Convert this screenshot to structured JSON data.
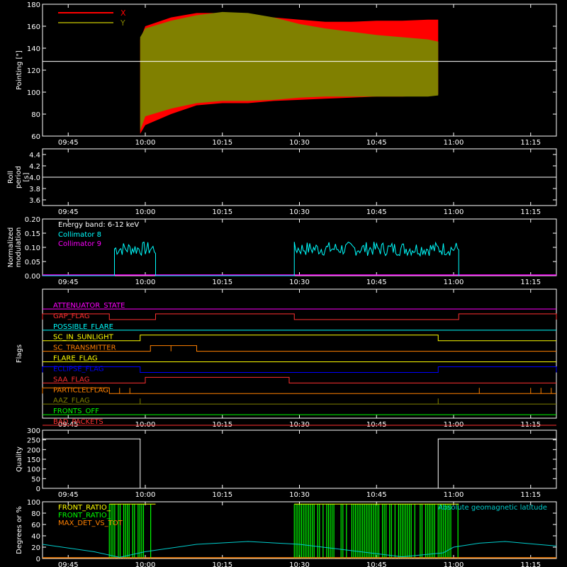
{
  "colors": {
    "background": "#000000",
    "axis": "#ffffff",
    "x_series": "#ff0000",
    "y_series": "#808000",
    "collimator8": "#00ffff",
    "collimator9": "#ff00ff",
    "quality": "#ffffff",
    "front_ratio_a": "#ffff00",
    "front_ratio_b": "#00ff00",
    "max_det": "#ff8000",
    "latitude": "#00cccc"
  },
  "chart_data": [
    {
      "id": "pointing",
      "type": "area",
      "ylabel": "Pointing [\"]",
      "ylim": [
        60,
        180
      ],
      "yticks": [
        60,
        80,
        100,
        120,
        140,
        160,
        180
      ],
      "xticks": [
        "09:45",
        "10:00",
        "10:15",
        "10:30",
        "10:45",
        "11:00",
        "11:15"
      ],
      "reference_line": 128,
      "legend": [
        {
          "name": "X",
          "color": "#ff0000"
        },
        {
          "name": "Y",
          "color": "#808000"
        }
      ],
      "series": [
        {
          "name": "X",
          "x": [
            "09:59",
            "10:00",
            "10:05",
            "10:10",
            "10:15",
            "10:20",
            "10:25",
            "10:30",
            "10:35",
            "10:40",
            "10:45",
            "10:50",
            "10:55",
            "10:57"
          ],
          "ymin": [
            62,
            70,
            80,
            88,
            90,
            90,
            92,
            93,
            94,
            95,
            96,
            96,
            97,
            98
          ],
          "ymax": [
            148,
            160,
            168,
            172,
            172,
            170,
            168,
            166,
            164,
            164,
            165,
            165,
            166,
            166
          ]
        },
        {
          "name": "Y",
          "x": [
            "09:59",
            "10:00",
            "10:05",
            "10:10",
            "10:15",
            "10:20",
            "10:25",
            "10:30",
            "10:35",
            "10:40",
            "10:45",
            "10:50",
            "10:55",
            "10:57"
          ],
          "ymin": [
            65,
            78,
            85,
            90,
            92,
            92,
            93,
            95,
            96,
            96,
            96,
            96,
            96,
            97
          ],
          "ymax": [
            150,
            158,
            165,
            170,
            173,
            172,
            168,
            162,
            158,
            155,
            152,
            150,
            148,
            146
          ]
        }
      ]
    },
    {
      "id": "roll",
      "type": "line",
      "ylabel": "Roll period [s]",
      "ylim": [
        3.5,
        4.5
      ],
      "yticks": [
        3.6,
        3.8,
        4.0,
        4.2,
        4.4
      ],
      "ytick_labels": [
        "3.6",
        "3.8",
        "4.0",
        "4.2",
        "4.4"
      ],
      "xticks": [
        "09:45",
        "10:00",
        "10:15",
        "10:30",
        "10:45",
        "11:00",
        "11:15"
      ],
      "series": [
        {
          "x": [
            "09:40",
            "11:20"
          ],
          "values": [
            4.0,
            4.0
          ]
        }
      ]
    },
    {
      "id": "modulation",
      "type": "line",
      "ylabel": "Normalized modulation",
      "ylim": [
        0,
        0.2
      ],
      "yticks": [
        0,
        0.05,
        0.1,
        0.15,
        0.2
      ],
      "ytick_labels": [
        "0.00",
        "0.05",
        "0.10",
        "0.15",
        "0.20"
      ],
      "xticks": [
        "09:45",
        "10:00",
        "10:15",
        "10:30",
        "10:45",
        "11:00",
        "11:15"
      ],
      "legend_title": "Energy band: 6-12 keV",
      "legend": [
        {
          "name": "Collimator 8",
          "color": "#00ffff"
        },
        {
          "name": "Collimator 9",
          "color": "#ff00ff"
        }
      ],
      "series": [
        {
          "name": "Collimator 8",
          "active_intervals": [
            [
              "09:54",
              "10:02"
            ],
            [
              "10:29",
              "11:01"
            ]
          ],
          "mean": 0.095,
          "spread": 0.025
        },
        {
          "name": "Collimator 9",
          "x": [
            "09:40",
            "11:20"
          ],
          "values": [
            0,
            0
          ]
        }
      ]
    },
    {
      "id": "flags",
      "type": "line",
      "ylabel": "Flags",
      "xticks": [
        "09:45",
        "10:00",
        "10:15",
        "10:30",
        "10:45",
        "11:00",
        "11:15"
      ],
      "flags": [
        {
          "name": "ATTENUATOR_STATE",
          "color": "#ff00ff",
          "high": [],
          "spikes": []
        },
        {
          "name": "GAP_FLAG",
          "color": "#ff3030",
          "high": [
            [
              "09:40",
              "09:53"
            ],
            [
              "10:02",
              "10:29"
            ],
            [
              "11:01",
              "11:20"
            ]
          ],
          "spikes": []
        },
        {
          "name": "POSSIBLE_FLARE",
          "color": "#00ffff",
          "high": [],
          "spikes": []
        },
        {
          "name": "SC_IN_SUNLIGHT",
          "color": "#ffff00",
          "high": [
            [
              "09:59",
              "10:57"
            ]
          ],
          "spikes": []
        },
        {
          "name": "SC_TRANSMITTER",
          "color": "#ff8000",
          "high": [
            [
              "10:01",
              "10:10"
            ]
          ],
          "spikes": [
            "10:05"
          ]
        },
        {
          "name": "FLARE_FLAG",
          "color": "#ffff00",
          "high": [],
          "spikes": []
        },
        {
          "name": "ECLIPSE_FLAG",
          "color": "#0000ff",
          "high": [
            [
              "09:40",
              "09:59"
            ],
            [
              "10:57",
              "11:20"
            ]
          ],
          "spikes": []
        },
        {
          "name": "SAA_FLAG",
          "color": "#ff3030",
          "high": [
            [
              "10:00",
              "10:28"
            ]
          ],
          "spikes": []
        },
        {
          "name": "PARTICLELFLAG",
          "color": "#ff8000",
          "high": [
            [
              "09:40",
              "09:53"
            ]
          ],
          "spikes": [
            "09:55",
            "09:57",
            "11:05",
            "11:15",
            "11:17",
            "11:19"
          ]
        },
        {
          "name": "AAZ_FLAG",
          "color": "#808000",
          "high": [],
          "spikes": [
            "09:59",
            "10:57"
          ]
        },
        {
          "name": "FRONTS_OFF",
          "color": "#00ff00",
          "high": [],
          "spikes": []
        },
        {
          "name": "BAD_PACKETS",
          "color": "#ff3030",
          "high": [],
          "spikes": []
        }
      ]
    },
    {
      "id": "quality",
      "type": "line",
      "ylabel": "Quality",
      "ylim": [
        0,
        300
      ],
      "yticks": [
        0,
        50,
        100,
        150,
        200,
        250,
        300
      ],
      "xticks": [
        "09:45",
        "10:00",
        "10:15",
        "10:30",
        "10:45",
        "11:00",
        "11:15"
      ],
      "series": [
        {
          "x": [
            "09:40",
            "09:59",
            "09:59",
            "10:57",
            "10:57",
            "11:20"
          ],
          "values": [
            255,
            255,
            0,
            0,
            255,
            255
          ]
        }
      ]
    },
    {
      "id": "ratios",
      "type": "line",
      "ylabel": "Degrees or %",
      "ylim": [
        0,
        100
      ],
      "yticks": [
        0,
        20,
        40,
        60,
        80,
        100
      ],
      "xticks": [
        "09:45",
        "10:00",
        "10:15",
        "10:30",
        "10:45",
        "11:00",
        "11:15"
      ],
      "legend": [
        {
          "name": "FRONT_RATIO_",
          "color": "#ffff00"
        },
        {
          "name": "FRONT_RATIO_",
          "color": "#00ff00"
        },
        {
          "name": "MAX_DET_VS_TOT",
          "color": "#ff8000"
        }
      ],
      "annotation": "Absolute geomagnetic latitude",
      "latitude_curve": {
        "x": [
          "09:40",
          "09:50",
          "09:55",
          "10:00",
          "10:10",
          "10:20",
          "10:30",
          "10:40",
          "10:50",
          "10:58",
          "11:00",
          "11:05",
          "11:10",
          "11:20"
        ],
        "values": [
          25,
          12,
          2,
          12,
          25,
          30,
          25,
          14,
          3,
          10,
          20,
          27,
          30,
          22
        ]
      },
      "active_intervals": [
        [
          "09:53",
          "10:02"
        ],
        [
          "10:29",
          "11:01"
        ]
      ]
    }
  ]
}
